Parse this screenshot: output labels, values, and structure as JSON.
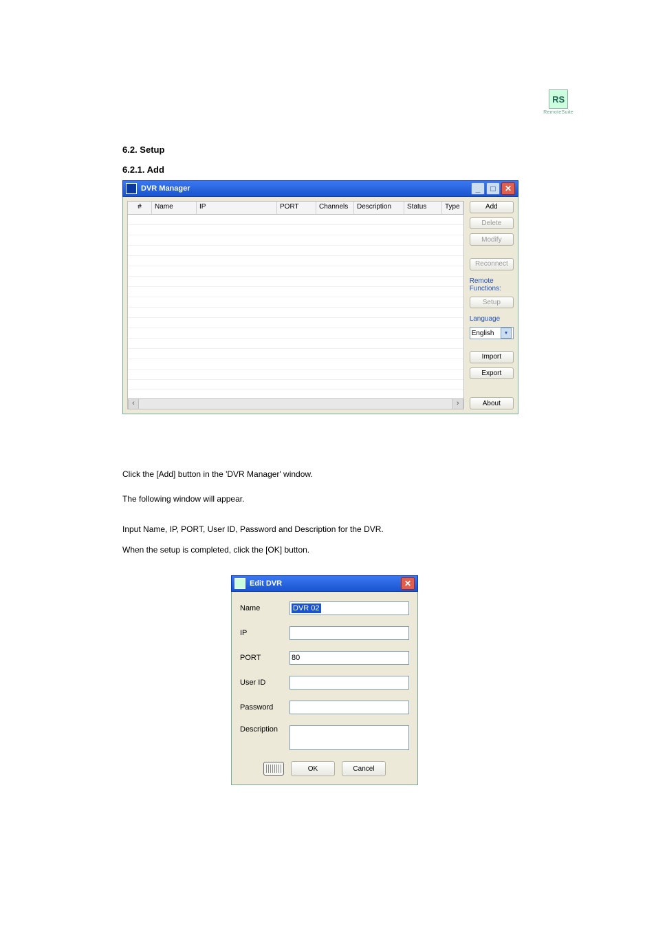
{
  "logo": {
    "mark": "RS",
    "label": "RemoteSuite"
  },
  "page": {
    "chapter": "6.2. Setup",
    "section": "6.2.1. Add"
  },
  "dvrManager": {
    "title": "DVR Manager",
    "columns": {
      "num": "#",
      "name": "Name",
      "ip": "IP",
      "port": "PORT",
      "channels": "Channels",
      "description": "Description",
      "status": "Status",
      "type": "Type"
    },
    "buttons": {
      "add": "Add",
      "delete": "Delete",
      "modify": "Modify",
      "reconnect": "Reconnect",
      "setup": "Setup",
      "import": "Import",
      "export": "Export",
      "about": "About"
    },
    "labels": {
      "remoteFunctions": "Remote Functions:",
      "language": "Language"
    },
    "language": {
      "selected": "English"
    }
  },
  "bodyText": {
    "line1a": "Click the [Add] button in the ",
    "line1q": "'",
    "line1b": "DVR Manager' window.",
    "line2": "The following window will appear.",
    "line3a": "Input Name, IP, PORT, User ID",
    "line3comma": ",",
    "line3b": " Password and Description for the DVR.",
    "line4": "When the setup is completed, click the [OK] button."
  },
  "editDvr": {
    "title": "Edit DVR",
    "fields": {
      "nameLabel": "Name",
      "nameValue": "DVR 02",
      "ipLabel": "IP",
      "ipValue": "",
      "portLabel": "PORT",
      "portValue": "80",
      "userIdLabel": "User ID",
      "userIdValue": "",
      "passwordLabel": "Password",
      "passwordValue": "",
      "descriptionLabel": "Description",
      "descriptionValue": ""
    },
    "buttons": {
      "ok": "OK",
      "cancel": "Cancel"
    }
  }
}
